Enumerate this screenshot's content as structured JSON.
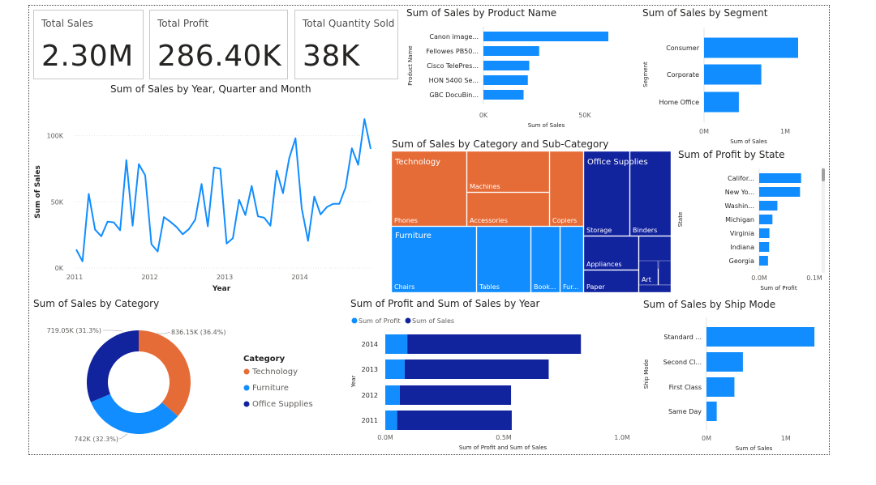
{
  "kpis": {
    "sales": {
      "label": "Total Sales",
      "value": "2.30M"
    },
    "profit": {
      "label": "Total Profit",
      "value": "286.40K"
    },
    "quantity": {
      "label": "Total Quantity Sold",
      "value": "38K"
    }
  },
  "colors": {
    "blue": "#118dff",
    "navy": "#12239e",
    "orange": "#e66c37",
    "grid": "#e6e6e6",
    "axis_text": "#605e5c"
  },
  "chart_data": [
    {
      "id": "line_year_month",
      "type": "line",
      "title": "Sum of Sales by Year, Quarter and Month",
      "xlabel": "Year",
      "ylabel": "Sum of Sales",
      "x_ticks": [
        "2011",
        "2012",
        "2013",
        "2014"
      ],
      "y_ticks": [
        "0K",
        "50K",
        "100K"
      ],
      "ylim": [
        0,
        115000
      ],
      "values": [
        14000,
        5000,
        56000,
        29000,
        24000,
        35000,
        34500,
        28500,
        81500,
        32000,
        78500,
        70000,
        18000,
        12500,
        38500,
        35000,
        31000,
        25500,
        29500,
        36500,
        63500,
        31500,
        76000,
        75000,
        18500,
        22500,
        51500,
        40000,
        62000,
        39000,
        38000,
        32000,
        73500,
        56500,
        83000,
        98000,
        45000,
        20500,
        54000,
        40500,
        46000,
        48500,
        48500,
        61000,
        90500,
        78000,
        112500,
        90000
      ]
    },
    {
      "id": "bar_product",
      "type": "bar",
      "orientation": "horizontal",
      "title": "Sum of Sales by Product Name",
      "ylabel": "Product Name",
      "xlabel": "Sum of Sales",
      "categories": [
        "Canon image...",
        "Fellowes PB50...",
        "Cisco TelePres...",
        "HON 5400 Se...",
        "GBC DocuBin..."
      ],
      "values": [
        61600,
        27500,
        22600,
        21900,
        19800
      ],
      "x_ticks": [
        "0K",
        "50K"
      ],
      "xlim": [
        0,
        70000
      ]
    },
    {
      "id": "bar_segment",
      "type": "bar",
      "orientation": "horizontal",
      "title": "Sum of Sales by Segment",
      "ylabel": "Segment",
      "xlabel": "Sum of Sales",
      "categories": [
        "Consumer",
        "Corporate",
        "Home Office"
      ],
      "values": [
        1160000,
        706000,
        429000
      ],
      "x_ticks": [
        "0M",
        "1M"
      ],
      "xlim": [
        0,
        1300000
      ]
    },
    {
      "id": "treemap_category",
      "type": "treemap",
      "title": "Sum of Sales by Category and Sub-Category",
      "groups": [
        {
          "name": "Technology",
          "children": [
            "Phones",
            "Machines",
            "Accessories",
            "Copiers"
          ]
        },
        {
          "name": "Furniture",
          "children": [
            "Chairs",
            "Tables",
            "Book...",
            "Fur..."
          ]
        },
        {
          "name": "Office Supplies",
          "children": [
            "Storage",
            "Binders",
            "Appliances",
            "Suppl...",
            "Art",
            "Paper"
          ]
        }
      ]
    },
    {
      "id": "bar_state",
      "type": "bar",
      "orientation": "horizontal",
      "title": "Sum of Profit by State",
      "ylabel": "State",
      "xlabel": "Sum of Profit",
      "categories": [
        "Califor...",
        "New Yo...",
        "Washin...",
        "Michigan",
        "Virginia",
        "Indiana",
        "Georgia"
      ],
      "values": [
        76000,
        74000,
        33000,
        24000,
        18500,
        18000,
        16000
      ],
      "x_ticks": [
        "0.0M",
        "0.1M"
      ],
      "xlim": [
        0,
        100000
      ]
    },
    {
      "id": "donut_category",
      "type": "pie",
      "title": "Sum of Sales by Category",
      "legend_title": "Category",
      "categories": [
        "Technology",
        "Furniture",
        "Office Supplies"
      ],
      "values": [
        836150,
        742000,
        719050
      ],
      "data_labels": [
        "836.15K (36.4%)",
        "742K (32.3%)",
        "719.05K (31.3%)"
      ]
    },
    {
      "id": "bar_profit_sales_year",
      "type": "bar",
      "orientation": "horizontal",
      "stacked": true,
      "title": "Sum of Profit and Sum of Sales by Year",
      "ylabel": "Year",
      "xlabel": "Sum of Profit and Sum of Sales",
      "categories": [
        "2014",
        "2013",
        "2012",
        "2011"
      ],
      "series": [
        {
          "name": "Sum of Profit",
          "values": [
            93000,
            82000,
            61000,
            50000
          ]
        },
        {
          "name": "Sum of Sales",
          "values": [
            733000,
            608000,
            470000,
            484000
          ]
        }
      ],
      "x_ticks": [
        "0.0M",
        "0.5M",
        "1.0M"
      ],
      "xlim": [
        0,
        1000000
      ]
    },
    {
      "id": "bar_shipmode",
      "type": "bar",
      "orientation": "horizontal",
      "title": "Sum of Sales by Ship Mode",
      "ylabel": "Ship Mode",
      "xlabel": "Sum of Sales",
      "categories": [
        "Standard ...",
        "Second Cl...",
        "First Class",
        "Same Day"
      ],
      "values": [
        1360000,
        459000,
        352000,
        129000
      ],
      "x_ticks": [
        "0M",
        "1M"
      ],
      "xlim": [
        0,
        1400000
      ]
    }
  ]
}
